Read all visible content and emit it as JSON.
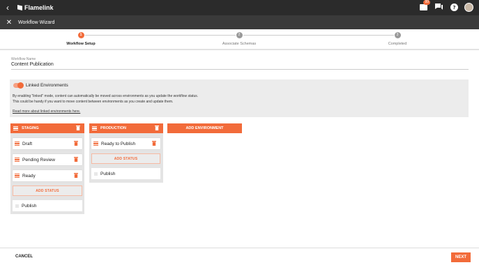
{
  "app": {
    "name": "Flamelink",
    "notification_count": "99"
  },
  "subbar": {
    "title": "Workflow Wizard"
  },
  "steps": [
    {
      "number": "1",
      "label": "Workflow Setup"
    },
    {
      "number": "2",
      "label": "Associate Schemas"
    },
    {
      "number": "3",
      "label": "Completed"
    }
  ],
  "workflow": {
    "name_label": "Workflow Name",
    "name_value": "Content Publication"
  },
  "linked": {
    "title": "Linked Environments",
    "desc_line1": "By enabling \"linked\" mode, content can automatically be moved across environments as you update the workflow status.",
    "desc_line2": "This could be handy if you want to move content between environments as you create and update them.",
    "link": "Read more about linked environments here."
  },
  "environments": [
    {
      "name": "STAGING",
      "statuses": [
        "Draft",
        "Pending Review",
        "Ready"
      ],
      "add_label": "ADD STATUS",
      "publish": "Publish"
    },
    {
      "name": "PRODUCTION",
      "statuses": [
        "Ready to Publish"
      ],
      "add_label": "ADD STATUS",
      "publish": "Publish"
    }
  ],
  "add_environment": "ADD ENVIRONMENT",
  "footer": {
    "cancel": "CANCEL",
    "next": "NEXT"
  },
  "colors": {
    "accent": "#f26b3a",
    "topbar": "#2b2b2b",
    "subbar": "#3a3a3a"
  }
}
